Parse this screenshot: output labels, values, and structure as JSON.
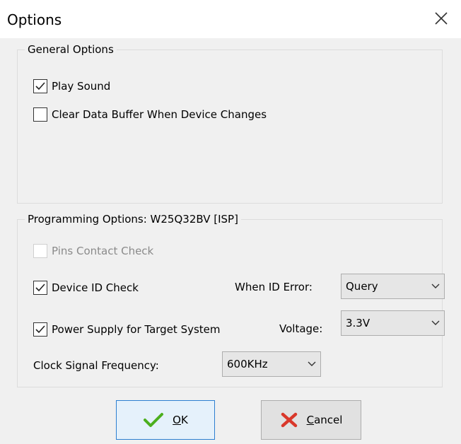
{
  "window": {
    "title": "Options"
  },
  "general": {
    "legend": "General Options",
    "play_sound": {
      "label": "Play Sound",
      "checked": true
    },
    "clear_buffer": {
      "label": "Clear Data Buffer When Device Changes",
      "checked": false
    }
  },
  "programming": {
    "legend": "Programming Options:  W25Q32BV [ISP]",
    "pins_contact": {
      "label": "Pins Contact Check",
      "checked": false,
      "enabled": false
    },
    "device_id": {
      "label": "Device ID Check",
      "checked": true
    },
    "id_error_label": "When ID Error:",
    "id_error_value": "Query",
    "power_supply": {
      "label": "Power Supply for Target System",
      "checked": true
    },
    "voltage_label": "Voltage:",
    "voltage_value": "3.3V",
    "clock_label": "Clock Signal Frequency:",
    "clock_value": "600KHz"
  },
  "buttons": {
    "ok": {
      "mnemonic": "O",
      "rest": "K"
    },
    "cancel": {
      "mnemonic": "C",
      "rest": "ancel"
    }
  },
  "colors": {
    "accent": "#2d7fd1",
    "ok_check": "#4caf1e",
    "cancel_x": "#d9382b"
  }
}
